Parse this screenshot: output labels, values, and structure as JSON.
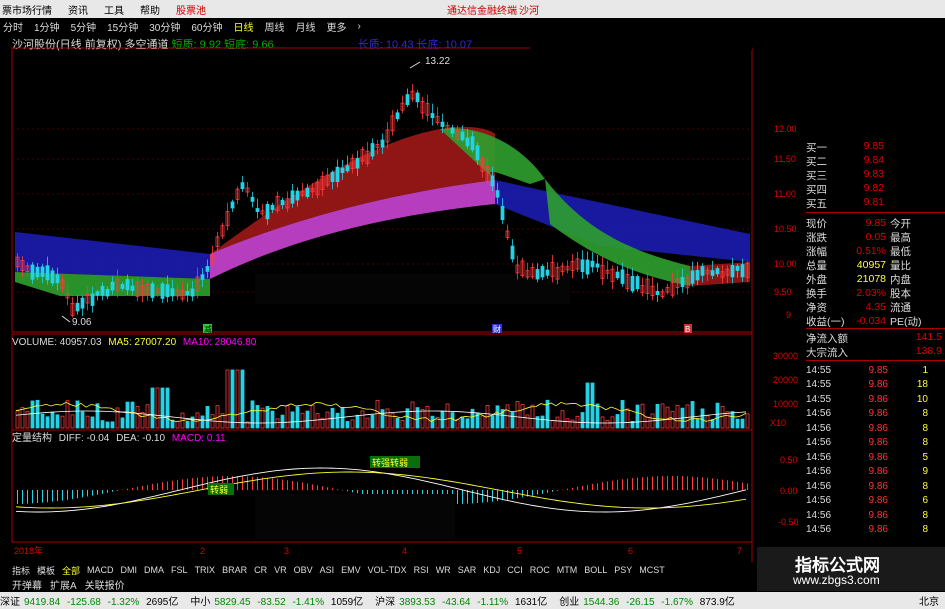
{
  "menu": {
    "items": [
      "票市场行情",
      "资讯",
      "工具",
      "帮助",
      "股票池"
    ],
    "right_link": "通达信金融终端",
    "right_link2": "沙河"
  },
  "periods": [
    "分时",
    "1分钟",
    "5分钟",
    "15分钟",
    "30分钟",
    "60分钟",
    "日线",
    "周线",
    "月线",
    "更多",
    "›"
  ],
  "active_period": "日线",
  "info": {
    "stock": "沙河股份",
    "adj": "(日线 前复权)",
    "indicator": "多空通道",
    "short_label": "短质:",
    "short_value": "9.92",
    "short2_label": "短底:",
    "short2_value": "9.66",
    "long_label": "长质:",
    "long_value": "10.43",
    "long2_label": "长底:",
    "long2_value": "10.07"
  },
  "price_chart": {
    "high_label": "13.22",
    "low_label": "9.06",
    "axis_ticks": [
      "12.00",
      "11.50",
      "11.00",
      "10.50",
      "10.00",
      "9.50",
      "9"
    ],
    "markers": [
      "减",
      "财",
      "B"
    ]
  },
  "volume_panel": {
    "label": "VOLUME:",
    "volume": "40957.03",
    "ma5_label": "MA5:",
    "ma5": "27007.20",
    "ma10_label": "MA10:",
    "ma10": "28046.80",
    "axis_ticks": [
      "30000",
      "20000",
      "10000",
      "X10"
    ]
  },
  "macd_panel": {
    "label": "定量结构",
    "diff_label": "DIFF:",
    "diff": "-0.04",
    "dea_label": "DEA:",
    "dea": "-0.10",
    "macd_label": "MACD:",
    "macd": "0.11",
    "axis_ticks": [
      "0.50",
      "0.00",
      "-0.50"
    ],
    "tags": [
      "转弱",
      "转强转弱"
    ]
  },
  "time_axis": {
    "year": "2018年",
    "months": [
      "2",
      "3",
      "4",
      "5",
      "6",
      "7"
    ]
  },
  "quote": {
    "orders": [
      {
        "label": "买一",
        "value": "9.85"
      },
      {
        "label": "买二",
        "value": "9.84"
      },
      {
        "label": "买三",
        "value": "9.83"
      },
      {
        "label": "买四",
        "value": "9.82"
      },
      {
        "label": "买五",
        "value": "9.81"
      }
    ],
    "stats": [
      {
        "l1": "现价",
        "v1": "9.85",
        "l2": "今开"
      },
      {
        "l1": "涨跌",
        "v1": "0.05",
        "l2": "最高"
      },
      {
        "l1": "涨幅",
        "v1": "0.51%",
        "l2": "最低"
      },
      {
        "l1": "总量",
        "v1": "40957",
        "l2": "量比"
      },
      {
        "l1": "外盘",
        "v1": "21078",
        "l2": "内盘"
      },
      {
        "l1": "换手",
        "v1": "2.03%",
        "l2": "股本"
      },
      {
        "l1": "净资",
        "v1": "4.35",
        "l2": "流通"
      },
      {
        "l1": "收益(一)",
        "v1": "-0.034",
        "l2": "PE(动)"
      }
    ],
    "flow": [
      {
        "label": "净流入额",
        "value": "141.5"
      },
      {
        "label": "大宗流入",
        "value": "138.9"
      }
    ],
    "ticks": [
      {
        "t": "14:55",
        "p": "9.85",
        "v": "1"
      },
      {
        "t": "14:55",
        "p": "9.86",
        "v": "18"
      },
      {
        "t": "14:55",
        "p": "9.86",
        "v": "10"
      },
      {
        "t": "14:56",
        "p": "9.86",
        "v": "8"
      },
      {
        "t": "14:56",
        "p": "9.86",
        "v": "8"
      },
      {
        "t": "14:56",
        "p": "9.86",
        "v": "8"
      },
      {
        "t": "14:56",
        "p": "9.86",
        "v": "5"
      },
      {
        "t": "14:56",
        "p": "9.86",
        "v": "9"
      },
      {
        "t": "14:56",
        "p": "9.86",
        "v": "8"
      },
      {
        "t": "14:56",
        "p": "9.86",
        "v": "6"
      },
      {
        "t": "14:56",
        "p": "9.86",
        "v": "8"
      },
      {
        "t": "14:56",
        "p": "9.86",
        "v": "8"
      }
    ]
  },
  "indicator_tabs": [
    "指标",
    "模板",
    "全部",
    "MACD",
    "DMI",
    "DMA",
    "FSL",
    "TRIX",
    "BRAR",
    "CR",
    "VR",
    "OBV",
    "ASI",
    "EMV",
    "VOL-TDX",
    "RSI",
    "WR",
    "SAR",
    "KDJ",
    "CCI",
    "ROC",
    "MTM",
    "BOLL",
    "PSY",
    "MCST"
  ],
  "active_tab": "全部",
  "sub_tabs": [
    "开弹幕",
    "扩展A",
    "关联报价"
  ],
  "status": {
    "items": [
      {
        "name": "深证",
        "value": "9419.84",
        "chg": "-125.68",
        "pct": "-1.32%",
        "amt": "2695亿"
      },
      {
        "name": "中小",
        "value": "5829.45",
        "chg": "-83.52",
        "pct": "-1.41%",
        "amt": "1059亿"
      },
      {
        "name": "沪深",
        "value": "3893.53",
        "chg": "-43.64",
        "pct": "-1.11%",
        "amt": "1631亿"
      },
      {
        "name": "创业",
        "value": "1544.36",
        "chg": "-26.15",
        "pct": "-1.67%",
        "amt": "873.9亿"
      }
    ],
    "right": "北京"
  },
  "watermark": {
    "title": "指标公式网",
    "url": "www.zbgs3.com"
  },
  "colors": {
    "up": "#ff3c3c",
    "down": "#22d3e6",
    "band_blue": "#1a1aa8",
    "band_green": "#2fa02f",
    "band_magenta": "#c040c8",
    "band_red": "#a01818"
  }
}
